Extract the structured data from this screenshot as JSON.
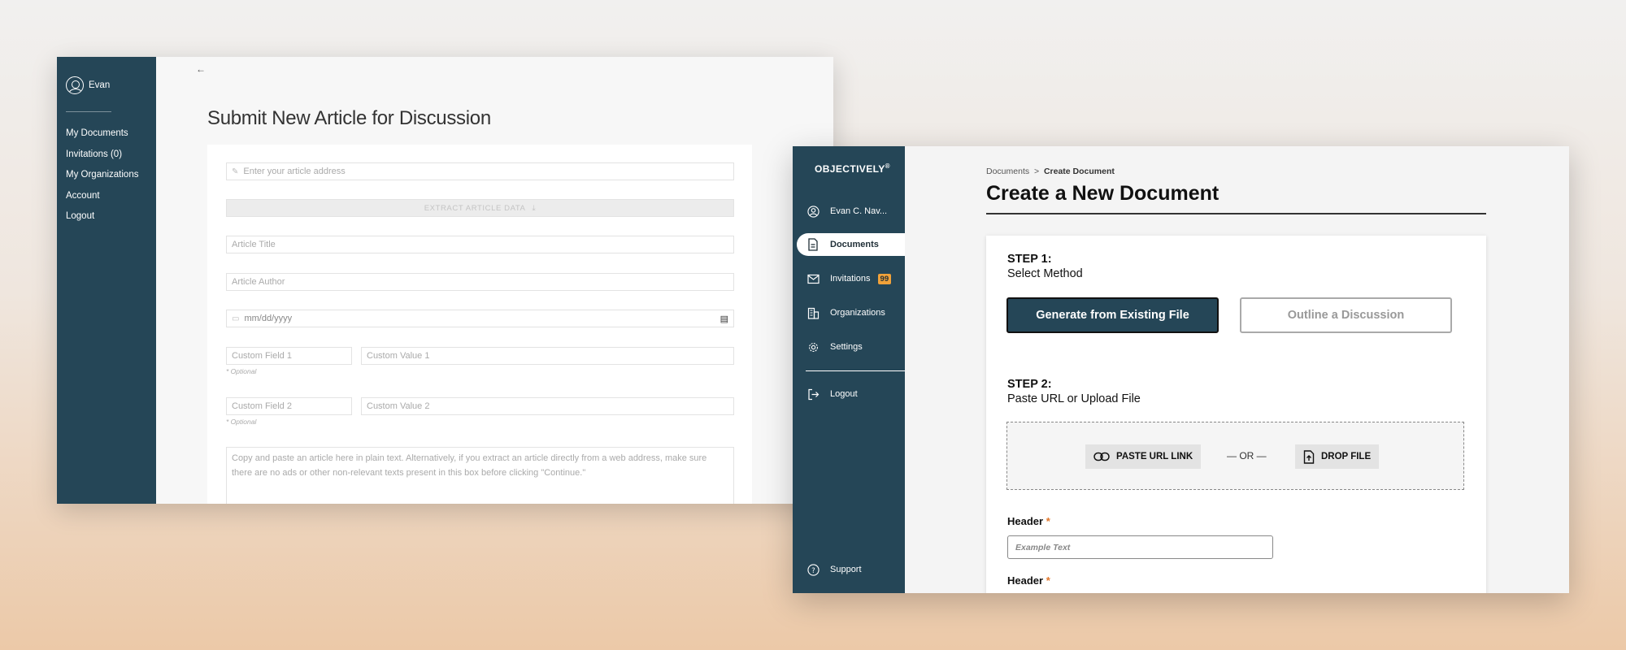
{
  "left_window": {
    "user_name": "Evan",
    "nav": [
      "My Documents",
      "Invitations (0)",
      "My Organizations",
      "Account",
      "Logout"
    ],
    "back_arrow": "←",
    "page_title": "Submit New Article for Discussion",
    "form": {
      "address_placeholder": "Enter your article address",
      "extract_label": "EXTRACT ARTICLE DATA",
      "title_placeholder": "Article Title",
      "author_placeholder": "Article Author",
      "date_placeholder": "mm/dd/yyyy",
      "custom_field_1": "Custom Field 1",
      "custom_value_1": "Custom Value 1",
      "custom_field_2": "Custom Field 2",
      "custom_value_2": "Custom Value 2",
      "optional": "* Optional",
      "textarea_placeholder": "Copy and paste an article here in plain text. Alternatively, if you extract an article directly from a web address, make sure there are no ads or other non-relevant texts present in this box before clicking \"Continue.\""
    }
  },
  "right_window": {
    "brand": "OBJECTIVELY",
    "brand_mark": "®",
    "nav": {
      "user": "Evan C. Nav...",
      "documents": "Documents",
      "invitations": "Invitations",
      "invitations_count": "99",
      "organizations": "Organizations",
      "settings": "Settings",
      "logout": "Logout",
      "support": "Support"
    },
    "breadcrumb": {
      "parent": "Documents",
      "separator": ">",
      "current": "Create Document"
    },
    "page_title": "Create a New Document",
    "step1": {
      "title": "STEP 1:",
      "subtitle": "Select Method"
    },
    "method_buttons": {
      "primary": "Generate from Existing File",
      "secondary": "Outline a Discussion"
    },
    "step2": {
      "title": "STEP 2:",
      "subtitle": "Paste URL or Upload File"
    },
    "upload": {
      "paste_url": "PASTE URL LINK",
      "or": "— OR —",
      "drop_file": "DROP FILE"
    },
    "fields": [
      {
        "label": "Header",
        "required": "*",
        "placeholder": "Example Text"
      },
      {
        "label": "Header",
        "required": "*"
      }
    ],
    "colors": {
      "sidebar": "#254657",
      "accent_badge": "#f0a23a",
      "required": "#e0762a"
    }
  }
}
